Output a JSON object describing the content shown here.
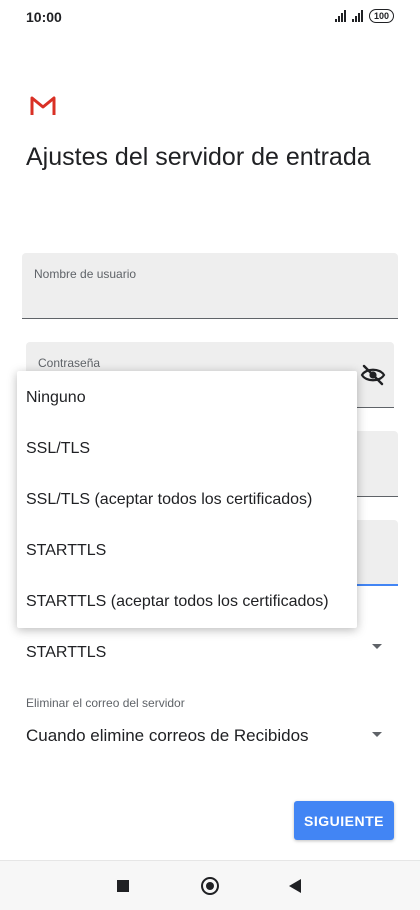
{
  "status_bar": {
    "time": "10:00",
    "battery": "100",
    "icons": [
      "signal-icon",
      "signal-icon",
      "battery-icon"
    ]
  },
  "app": {
    "logo_icon": "gmail-logo-icon",
    "page_title": "Ajustes del servidor de entrada"
  },
  "form": {
    "username": {
      "label": "Nombre de usuario",
      "value": ""
    },
    "password": {
      "label": "Contraseña",
      "value": "",
      "toggle_icon": "visibility-off-icon"
    }
  },
  "security_menu": {
    "options": [
      "Ninguno",
      "SSL/TLS",
      "SSL/TLS (aceptar todos los certificados)",
      "STARTTLS",
      "STARTTLS (aceptar todos los certificados)"
    ]
  },
  "security": {
    "selected": "STARTTLS"
  },
  "delete_mail": {
    "label": "Eliminar el correo del servidor",
    "selected": "Cuando elimine correos de Recibidos"
  },
  "actions": {
    "next_label": "SIGUIENTE"
  },
  "colors": {
    "accent": "#4285f4",
    "gmail_red": "#d93025",
    "field_bg": "#eeeeee"
  },
  "navbar": {
    "icons": [
      "recents-square-icon",
      "home-circle-icon",
      "back-triangle-icon"
    ]
  }
}
